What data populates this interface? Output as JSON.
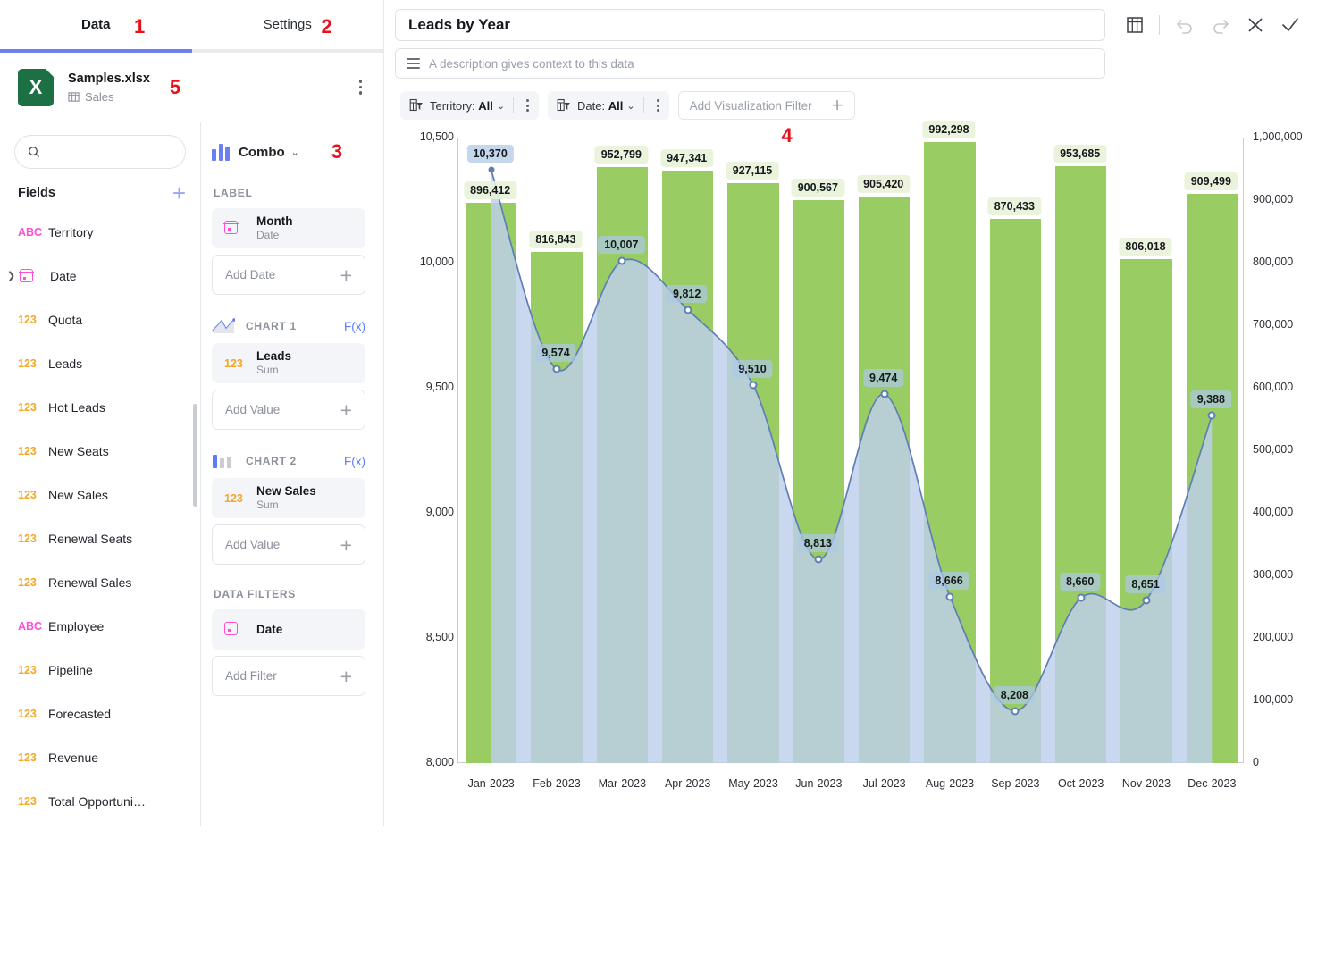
{
  "tabs": {
    "data_label": "Data",
    "settings_label": "Settings",
    "badge_data": "1",
    "badge_settings": "2",
    "badge_file": "5",
    "badge_combo": "3",
    "badge_filter": "4"
  },
  "file": {
    "name": "Samples.xlsx",
    "sheet": "Sales",
    "icon": "excel-icon",
    "menu_icon": "kebab-icon"
  },
  "search": {
    "placeholder": "",
    "value": "",
    "icon": "search-icon"
  },
  "fields_panel": {
    "title": "Fields",
    "add_icon": "plus-icon",
    "items": [
      {
        "type": "ABC",
        "kind": "text",
        "label": "Territory",
        "expandable": false
      },
      {
        "type": "",
        "kind": "date",
        "label": "Date",
        "expandable": true
      },
      {
        "type": "123",
        "kind": "number",
        "label": "Quota",
        "expandable": false
      },
      {
        "type": "123",
        "kind": "number",
        "label": "Leads",
        "expandable": false
      },
      {
        "type": "123",
        "kind": "number",
        "label": "Hot Leads",
        "expandable": false
      },
      {
        "type": "123",
        "kind": "number",
        "label": "New Seats",
        "expandable": false
      },
      {
        "type": "123",
        "kind": "number",
        "label": "New Sales",
        "expandable": false
      },
      {
        "type": "123",
        "kind": "number",
        "label": "Renewal Seats",
        "expandable": false
      },
      {
        "type": "123",
        "kind": "number",
        "label": "Renewal Sales",
        "expandable": false
      },
      {
        "type": "ABC",
        "kind": "text",
        "label": "Employee",
        "expandable": false
      },
      {
        "type": "123",
        "kind": "number",
        "label": "Pipeline",
        "expandable": false
      },
      {
        "type": "123",
        "kind": "number",
        "label": "Forecasted",
        "expandable": false
      },
      {
        "type": "123",
        "kind": "number",
        "label": "Revenue",
        "expandable": false
      },
      {
        "type": "123",
        "kind": "number",
        "label": "Total Opportuni…",
        "expandable": false
      }
    ]
  },
  "config_panel": {
    "chart_type": "Combo",
    "label_section": {
      "title": "LABEL",
      "field_name": "Month",
      "field_sub": "Date",
      "add_label": "Add Date"
    },
    "chart1": {
      "title": "CHART 1",
      "fx": "F(x)",
      "field_type": "123",
      "field_name": "Leads",
      "field_sub": "Sum",
      "add_label": "Add Value"
    },
    "chart2": {
      "title": "CHART 2",
      "fx": "F(x)",
      "field_type": "123",
      "field_name": "New Sales",
      "field_sub": "Sum",
      "add_label": "Add Value"
    },
    "data_filters": {
      "title": "DATA FILTERS",
      "field_name": "Date",
      "add_label": "Add Filter"
    }
  },
  "viz": {
    "title": "Leads by Year",
    "description_placeholder": "A description gives context to this data",
    "toolbar": [
      {
        "name": "table-icon",
        "glyph": "table"
      },
      {
        "name": "undo-icon",
        "glyph": "undo"
      },
      {
        "name": "redo-icon",
        "glyph": "redo"
      },
      {
        "name": "close-icon",
        "glyph": "x"
      },
      {
        "name": "confirm-icon",
        "glyph": "check"
      }
    ],
    "filters": [
      {
        "label": "Territory:",
        "value": "All"
      },
      {
        "label": "Date:",
        "value": "All"
      }
    ],
    "add_filter_label": "Add Visualization Filter"
  },
  "chart_data": {
    "type": "bar",
    "title": "Leads by Year",
    "xlabel": "",
    "categories": [
      "Jan-2023",
      "Feb-2023",
      "Mar-2023",
      "Apr-2023",
      "May-2023",
      "Jun-2023",
      "Jul-2023",
      "Aug-2023",
      "Sep-2023",
      "Oct-2023",
      "Nov-2023",
      "Dec-2023"
    ],
    "series": [
      {
        "name": "New Sales (Sum)",
        "type": "bar",
        "axis": "right",
        "color": "#99cc63",
        "values": [
          896412,
          816843,
          952799,
          947341,
          927115,
          900567,
          905420,
          992298,
          870433,
          953685,
          806018,
          909499
        ],
        "labels": [
          "896,412",
          "816,843",
          "952,799",
          "947,341",
          "927,115",
          "900,567",
          "905,420",
          "992,298",
          "870,433",
          "953,685",
          "806,018",
          "909,499"
        ]
      },
      {
        "name": "Leads (Sum)",
        "type": "line-area",
        "axis": "left",
        "color": "#5d7fb5",
        "fill": "#bdd0ea",
        "values": [
          10370,
          9574,
          10007,
          9812,
          9510,
          8813,
          9474,
          8666,
          8208,
          8660,
          8651,
          9388
        ],
        "labels": [
          "10,370",
          "9,574",
          "10,007",
          "9,812",
          "9,510",
          "8,813",
          "9,474",
          "8,666",
          "8,208",
          "8,660",
          "8,651",
          "9,388"
        ]
      }
    ],
    "left_axis": {
      "label": "",
      "min": 8000,
      "max": 10500,
      "step": 500,
      "ticks": [
        "10,500",
        "10,000",
        "9,500",
        "9,000",
        "8,500",
        "8,000"
      ]
    },
    "right_axis": {
      "label": "",
      "min": 0,
      "max": 1000000,
      "step": 100000,
      "ticks": [
        "1,000,000",
        "900,000",
        "800,000",
        "700,000",
        "600,000",
        "500,000",
        "400,000",
        "300,000",
        "200,000",
        "100,000",
        "0"
      ]
    },
    "grid": false,
    "legend": "none"
  }
}
